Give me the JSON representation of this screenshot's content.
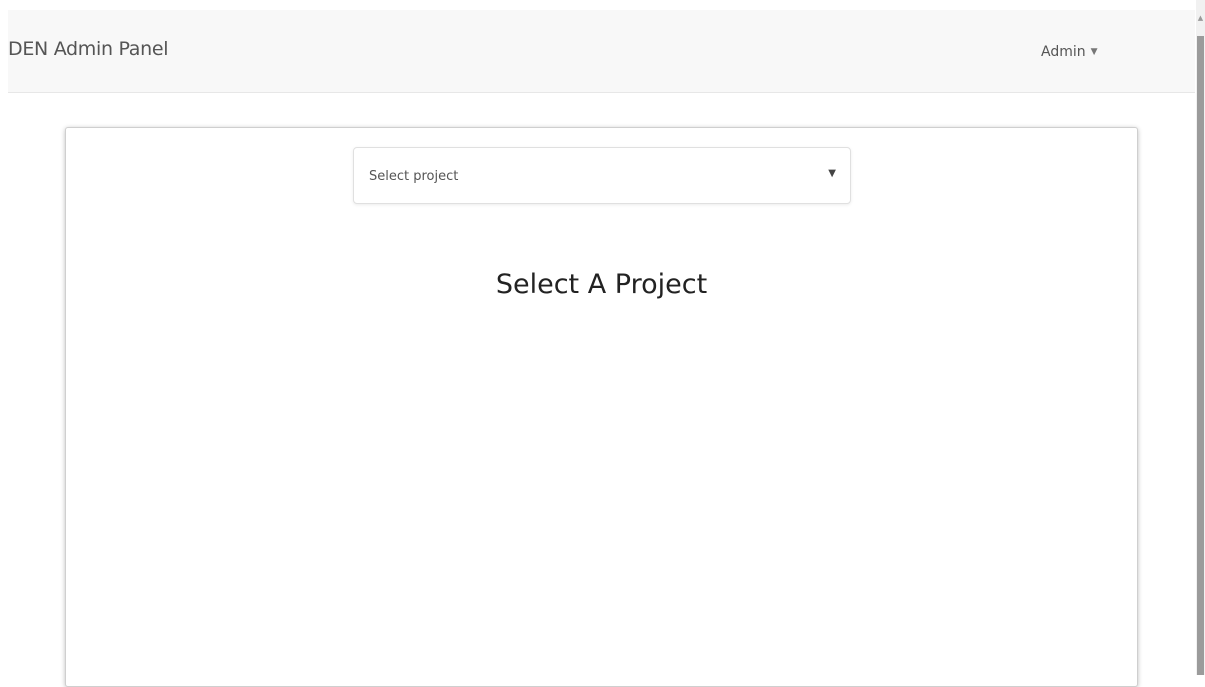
{
  "navbar": {
    "brand": "DEN Admin Panel",
    "user": {
      "label": "Admin",
      "icon": "caret-down-icon"
    }
  },
  "main": {
    "project_select": {
      "value": "Select project",
      "icon": "chevron-down-icon"
    },
    "heading": "Select A Project"
  },
  "colors": {
    "navbar_bg": "#f8f8f8",
    "panel_border": "#cfcfcf",
    "text": "#333333"
  }
}
